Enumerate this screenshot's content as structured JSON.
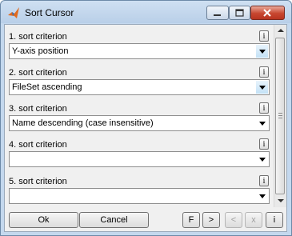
{
  "window": {
    "title": "Sort Cursor"
  },
  "criteria": [
    {
      "label": "1. sort criterion",
      "value": "Y-axis position"
    },
    {
      "label": "2. sort criterion",
      "value": "FileSet ascending"
    },
    {
      "label": "3. sort criterion",
      "value": "Name descending (case insensitive)"
    },
    {
      "label": "4. sort criterion",
      "value": ""
    },
    {
      "label": "5. sort criterion",
      "value": ""
    }
  ],
  "info_label": "i",
  "buttons": {
    "ok": "Ok",
    "cancel": "Cancel",
    "f": "F",
    "next": ">",
    "prev": "<",
    "x": "x",
    "info": "i"
  },
  "colors": {
    "title_bar": "#b9cfe8",
    "close_button": "#c7462f",
    "panel": "#f0f0f0"
  }
}
